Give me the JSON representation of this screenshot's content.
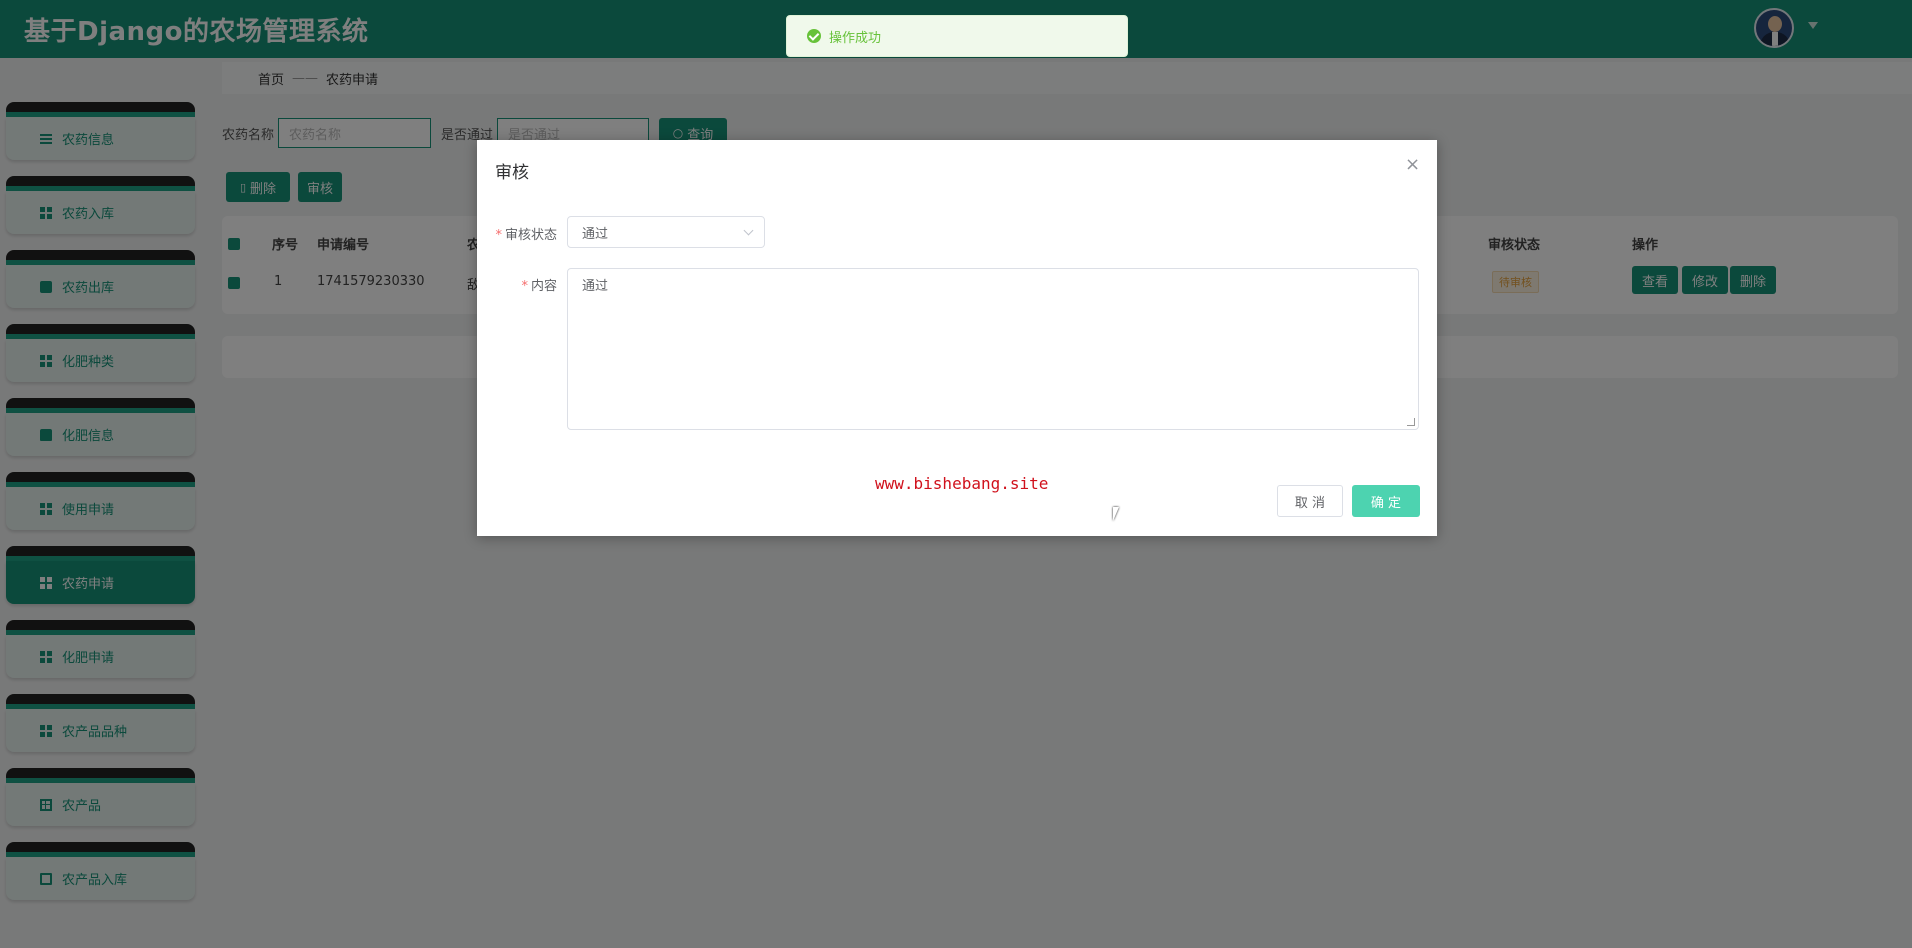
{
  "header": {
    "title": "基于Django的农场管理系统"
  },
  "toast": {
    "message": "操作成功"
  },
  "sidebar": {
    "items": [
      {
        "label": "农药信息",
        "icon": "sliders-icon"
      },
      {
        "label": "农药入库",
        "icon": "grid-icon"
      },
      {
        "label": "农药出库",
        "icon": "chat-icon"
      },
      {
        "label": "化肥种类",
        "icon": "grid-icon"
      },
      {
        "label": "化肥信息",
        "icon": "thumb-icon"
      },
      {
        "label": "使用申请",
        "icon": "grid-icon"
      },
      {
        "label": "农药申请",
        "icon": "grid-icon",
        "active": true
      },
      {
        "label": "化肥申请",
        "icon": "grid-icon"
      },
      {
        "label": "农产品品种",
        "icon": "grid-icon"
      },
      {
        "label": "农产品",
        "icon": "table-icon"
      },
      {
        "label": "农产品入库",
        "icon": "clipboard-icon"
      }
    ]
  },
  "breadcrumb": {
    "home": "首页",
    "sep": "——",
    "current": "农药申请"
  },
  "filters": {
    "name_label": "农药名称",
    "name_placeholder": "农药名称",
    "pass_label": "是否通过",
    "pass_placeholder": "是否通过",
    "search_label": "查询"
  },
  "actions": {
    "delete_label": "删除",
    "review_label": "审核"
  },
  "table": {
    "headers": {
      "index": "序号",
      "code": "申请编号",
      "col3": "农",
      "status": "审核状态",
      "ops": "操作"
    },
    "row": {
      "index": "1",
      "code": "1741579230330",
      "col3": "敌",
      "status": "待审核"
    },
    "row_buttons": {
      "view": "查看",
      "edit": "修改",
      "delete": "删除"
    }
  },
  "dialog": {
    "title": "审核",
    "status_label": "审核状态",
    "status_value": "通过",
    "content_label": "内容",
    "content_value": "通过",
    "watermark": "www.bishebang.site",
    "cancel_label": "取 消",
    "ok_label": "确 定"
  },
  "colors": {
    "brand": "#179278",
    "ok_button": "#4dd3b0",
    "toast_success": "#67c23a"
  }
}
